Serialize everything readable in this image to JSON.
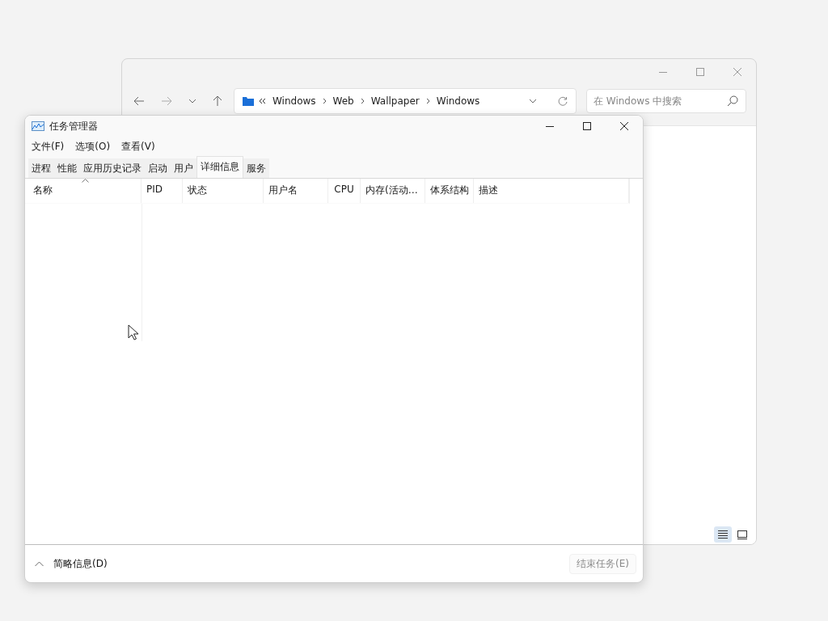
{
  "explorer": {
    "address": {
      "path": [
        "Windows",
        "Web",
        "Wallpaper",
        "Windows"
      ]
    },
    "search": {
      "placeholder": "在 Windows 中搜索"
    },
    "view_buttons": [
      {
        "kind": "details",
        "selected": true
      },
      {
        "kind": "tiles",
        "selected": false
      }
    ]
  },
  "task_manager": {
    "title": "任务管理器",
    "menu": [
      "文件(F)",
      "选项(O)",
      "查看(V)"
    ],
    "tabs": [
      {
        "label": "进程",
        "selected": false
      },
      {
        "label": "性能",
        "selected": false
      },
      {
        "label": "应用历史记录",
        "selected": false
      },
      {
        "label": "启动",
        "selected": false
      },
      {
        "label": "用户",
        "selected": false
      },
      {
        "label": "详细信息",
        "selected": true
      },
      {
        "label": "服务",
        "selected": false
      }
    ],
    "columns": [
      {
        "label": "名称",
        "sorted": true
      },
      {
        "label": "PID",
        "sorted": false
      },
      {
        "label": "状态",
        "sorted": false
      },
      {
        "label": "用户名",
        "sorted": false
      },
      {
        "label": "CPU",
        "sorted": false
      },
      {
        "label": "内存(活动…",
        "sorted": false
      },
      {
        "label": "体系结构",
        "sorted": false
      },
      {
        "label": "描述",
        "sorted": false
      }
    ],
    "footer": {
      "toggle": "简略信息(D)",
      "end_task": {
        "label": "结束任务(E)",
        "disabled": true
      }
    }
  }
}
